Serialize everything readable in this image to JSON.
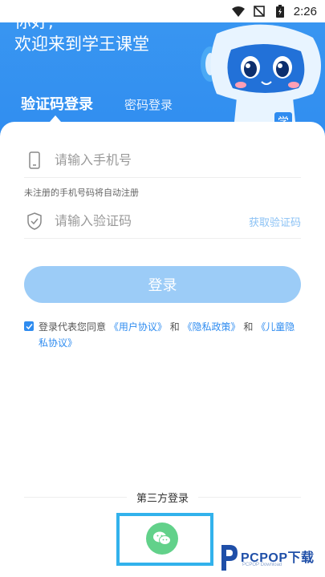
{
  "status_bar": {
    "time": "2:26",
    "icons": [
      "wifi-icon",
      "signal-muted-icon",
      "battery-charging-icon"
    ]
  },
  "header": {
    "greeting_line1": "你好,",
    "greeting_line2": "欢迎来到学王课堂",
    "mascot_badge": "学"
  },
  "tabs": [
    {
      "label": "验证码登录",
      "active": true
    },
    {
      "label": "密码登录",
      "active": false
    }
  ],
  "form": {
    "phone_placeholder": "请输入手机号",
    "hint": "未注册的手机号码将自动注册",
    "code_placeholder": "请输入验证码",
    "get_code_label": "获取验证码",
    "login_label": "登录"
  },
  "agreement": {
    "checked": true,
    "prefix": "登录代表您同意",
    "user_agreement": "《用户协议》",
    "and1": "和",
    "privacy": "《隐私政策》",
    "and2": "和",
    "child_privacy": "《儿童隐私协议》"
  },
  "third_party": {
    "title": "第三方登录",
    "wechat_icon": "wechat-icon"
  },
  "watermark": {
    "text": "PCPOP下载",
    "sub": "PCPOP Download"
  },
  "colors": {
    "primary": "#2f8cf0",
    "button_disabled": "#9cccf7",
    "wechat": "#62d18a",
    "highlight_frame": "#32b2ec"
  }
}
